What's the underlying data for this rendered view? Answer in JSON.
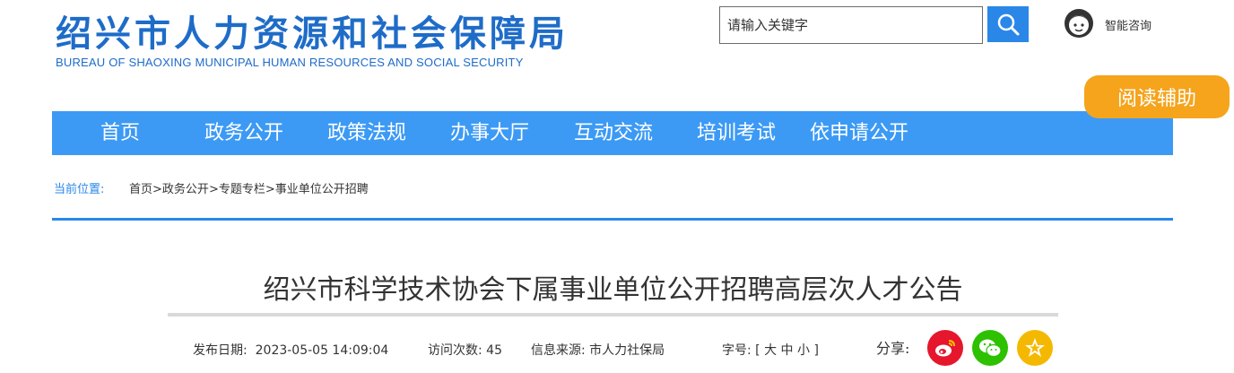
{
  "header": {
    "logo_cn": "绍兴市人力资源和社会保障局",
    "logo_en": "BUREAU OF SHAOXING MUNICIPAL HUMAN RESOURCES AND SOCIAL SECURITY",
    "search_placeholder": "请输入关键字",
    "assistant_label": "智能咨询",
    "reading_aid_label": "阅读辅助"
  },
  "nav": {
    "items": [
      "首页",
      "政务公开",
      "政策法规",
      "办事大厅",
      "互动交流",
      "培训考试",
      "依申请公开"
    ]
  },
  "breadcrumb": {
    "label": "当前位置:",
    "items": [
      "首页",
      "政务公开",
      "专题专栏",
      "事业单位公开招聘"
    ],
    "separator": ">"
  },
  "article": {
    "title": "绍兴市科学技术协会下属事业单位公开招聘高层次人才公告",
    "publish_label": "发布日期:",
    "publish_date": "2023-05-05 14:09:04",
    "visits_label": "访问次数:",
    "visits": "45",
    "source_label": "信息来源:",
    "source": "市人力社保局",
    "font_size_label": "字号:",
    "font_size_open": "[",
    "font_size_large": "大",
    "font_size_medium": "中",
    "font_size_small": "小",
    "font_size_close": "]",
    "share_label": "分享:"
  },
  "colors": {
    "brand_blue": "#1e6cc8",
    "nav_blue": "#3c9af5",
    "accent_orange": "#f5a41c",
    "weibo_red": "#e6162d",
    "wechat_green": "#2dc100",
    "star_yellow": "#f5b800"
  },
  "icons": {
    "search": "search-icon",
    "assistant": "assistant-avatar-icon",
    "share": [
      "weibo-icon",
      "wechat-icon",
      "star-icon"
    ]
  }
}
